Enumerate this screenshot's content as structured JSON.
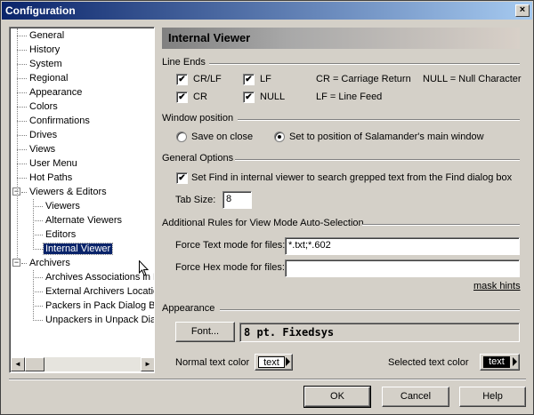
{
  "window": {
    "title": "Configuration",
    "close_glyph": "×"
  },
  "tree": {
    "items": [
      {
        "label": "General",
        "level": 1
      },
      {
        "label": "History",
        "level": 1
      },
      {
        "label": "System",
        "level": 1
      },
      {
        "label": "Regional",
        "level": 1
      },
      {
        "label": "Appearance",
        "level": 1
      },
      {
        "label": "Colors",
        "level": 1
      },
      {
        "label": "Confirmations",
        "level": 1
      },
      {
        "label": "Drives",
        "level": 1
      },
      {
        "label": "Views",
        "level": 1
      },
      {
        "label": "User Menu",
        "level": 1
      },
      {
        "label": "Hot Paths",
        "level": 1
      },
      {
        "label": "Viewers & Editors",
        "level": 1,
        "expander": "−"
      },
      {
        "label": "Viewers",
        "level": 2
      },
      {
        "label": "Alternate Viewers",
        "level": 2
      },
      {
        "label": "Editors",
        "level": 2
      },
      {
        "label": "Internal Viewer",
        "level": 2,
        "selected": true
      },
      {
        "label": "Archivers",
        "level": 1,
        "expander": "−"
      },
      {
        "label": "Archives Associations in P",
        "level": 2
      },
      {
        "label": "External Archivers Locatio",
        "level": 2
      },
      {
        "label": "Packers in Pack Dialog B",
        "level": 2
      },
      {
        "label": "Unpackers in Unpack Dia",
        "level": 2
      }
    ],
    "scroll_left": "◄",
    "scroll_right": "►"
  },
  "panel": {
    "header": "Internal Viewer",
    "line_ends": {
      "title": "Line Ends",
      "crlf": {
        "label": "CR/LF",
        "checked": true
      },
      "lf": {
        "label": "LF",
        "checked": true
      },
      "cr": {
        "label": "CR",
        "checked": true
      },
      "null": {
        "label": "NULL",
        "checked": true
      },
      "legend_cr": "CR = Carriage Return",
      "legend_null": "NULL = Null Character",
      "legend_lf": "LF = Line Feed",
      "check_glyph": "✔"
    },
    "window_position": {
      "title": "Window position",
      "save_on_close": {
        "label": "Save on close",
        "selected": false
      },
      "set_to_main": {
        "label": "Set to position of Salamander's main window",
        "selected": true
      }
    },
    "general_options": {
      "title": "General Options",
      "find_option": {
        "label": "Set Find in internal viewer to search grepped text from the Find dialog box",
        "checked": true
      },
      "tab_size_label": "Tab Size:",
      "tab_size_value": "8"
    },
    "auto_selection": {
      "title": "Additional Rules for View Mode Auto-Selection",
      "text_mode_label": "Force Text mode for files:",
      "text_mode_value": "*.txt;*.602",
      "hex_mode_label": "Force Hex mode for files:",
      "hex_mode_value": "",
      "mask_hints": "mask hints"
    },
    "appearance": {
      "title": "Appearance",
      "font_button": "Font...",
      "font_display": "8 pt. Fixedsys",
      "normal_color_label": "Normal text color",
      "normal_swatch_text": "text",
      "selected_color_label": "Selected text color",
      "selected_swatch_text": "text"
    }
  },
  "buttons": {
    "ok": "OK",
    "cancel": "Cancel",
    "help": "Help"
  },
  "colors": {
    "title_bar_start": "#0a246a",
    "title_bar_end": "#a6caf0",
    "selection": "#0a246a",
    "face": "#d4d0c8"
  }
}
